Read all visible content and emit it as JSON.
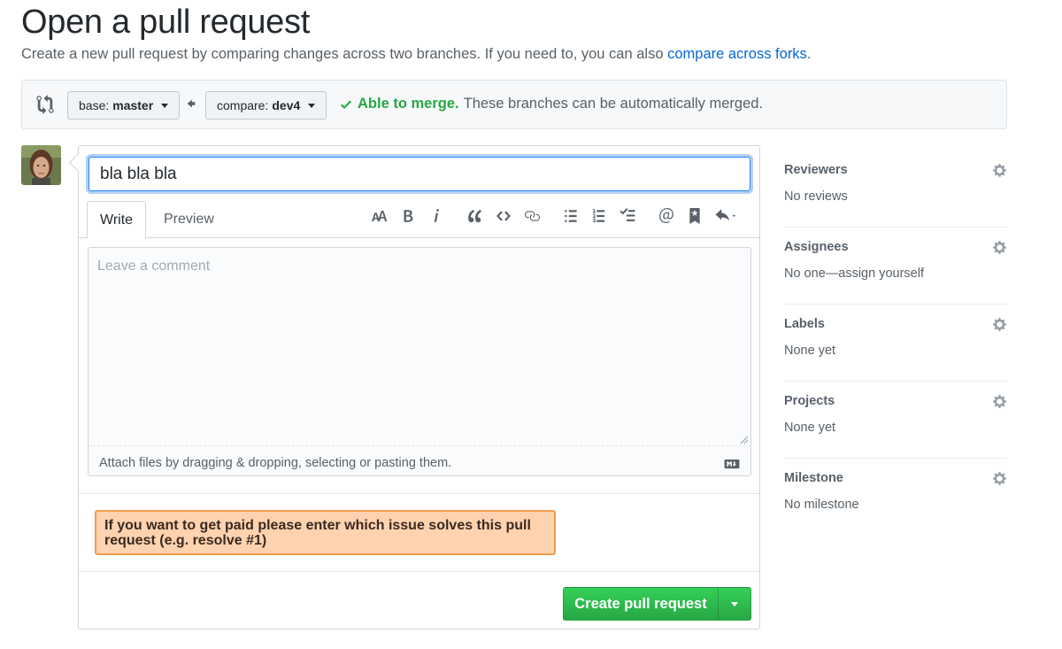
{
  "header": {
    "title": "Open a pull request",
    "subtitle": "Create a new pull request by comparing changes across two branches. If you need to, you can also ",
    "subtitle_link": "compare across forks",
    "subtitle_end": "."
  },
  "compare": {
    "base_prefix": "base: ",
    "base_branch": "master",
    "compare_prefix": "compare: ",
    "compare_branch": "dev4",
    "status_ok": "Able to merge.",
    "status_text": "These branches can be automatically merged."
  },
  "form": {
    "title_value": "bla bla bla",
    "tabs": {
      "write": "Write",
      "preview": "Preview"
    },
    "comment_placeholder": "Leave a comment",
    "attach_text": "Attach files by dragging & dropping, selecting or pasting them.",
    "bounty_notice": "If you want to get paid please enter which issue solves this pull request (e.g. resolve #1)",
    "create_label": "Create pull request"
  },
  "toolbar_icons": [
    "text-size-icon",
    "bold-icon",
    "italic-icon",
    "quote-icon",
    "code-icon",
    "link-icon",
    "unordered-list-icon",
    "ordered-list-icon",
    "task-list-icon",
    "mention-icon",
    "bookmark-icon",
    "reply-icon"
  ],
  "sidebar": {
    "sections": [
      {
        "heading": "Reviewers",
        "value": "No reviews"
      },
      {
        "heading": "Assignees",
        "value": "No one—assign yourself"
      },
      {
        "heading": "Labels",
        "value": "None yet"
      },
      {
        "heading": "Projects",
        "value": "None yet"
      },
      {
        "heading": "Milestone",
        "value": "No milestone"
      }
    ]
  },
  "colors": {
    "link": "#0366d6",
    "success": "#28a745",
    "bounty_bg": "#ffd2b0",
    "bounty_border": "#f29d4b",
    "focus": "#2188ff"
  }
}
